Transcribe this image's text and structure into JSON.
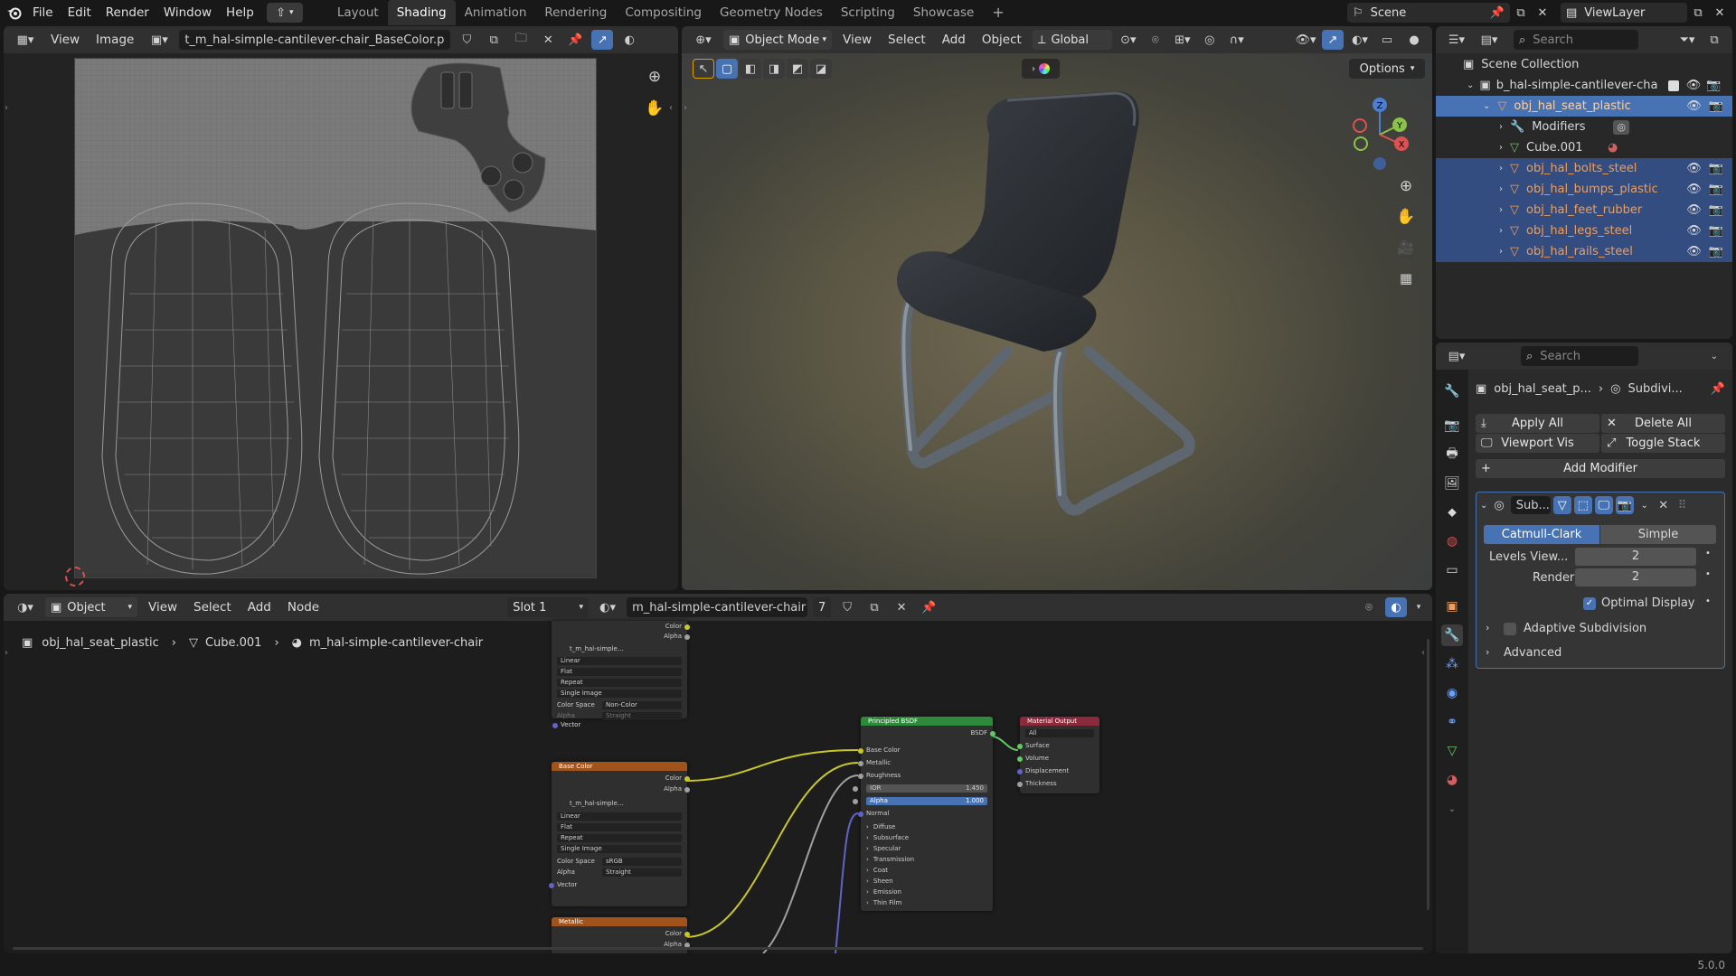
{
  "topbar": {
    "menus": [
      "File",
      "Edit",
      "Render",
      "Window",
      "Help"
    ],
    "workspaces": [
      "Layout",
      "Shading",
      "Animation",
      "Rendering",
      "Compositing",
      "Geometry Nodes",
      "Scripting",
      "Showcase"
    ],
    "active_workspace": "Shading",
    "scene": "Scene",
    "view_layer": "ViewLayer"
  },
  "image_editor": {
    "menus": [
      "View",
      "Image"
    ],
    "image_name": "t_m_hal-simple-cantilever-chair_BaseColor.png"
  },
  "viewport": {
    "mode": "Object Mode",
    "menus": [
      "View",
      "Select",
      "Add",
      "Object"
    ],
    "transform_orientation": "Global",
    "options_label": "Options",
    "gizmo": {
      "x": "X",
      "y": "Y",
      "z": "Z"
    }
  },
  "outliner": {
    "search_placeholder": "Search",
    "scene_collection": "Scene Collection",
    "collection": "b_hal-simple-cantilever-cha",
    "items": [
      {
        "label": "obj_hal_seat_plastic",
        "level": 1,
        "selected": true,
        "active": true
      },
      {
        "label": "Modifiers",
        "level": 2,
        "selected": false
      },
      {
        "label": "Cube.001",
        "level": 2,
        "selected": false
      },
      {
        "label": "obj_hal_bolts_steel",
        "level": 2,
        "selected": true
      },
      {
        "label": "obj_hal_bumps_plastic",
        "level": 2,
        "selected": true
      },
      {
        "label": "obj_hal_feet_rubber",
        "level": 2,
        "selected": true
      },
      {
        "label": "obj_hal_legs_steel",
        "level": 2,
        "selected": true
      },
      {
        "label": "obj_hal_rails_steel",
        "level": 2,
        "selected": true
      }
    ]
  },
  "properties": {
    "search_placeholder": "Search",
    "object_name": "obj_hal_seat_p...",
    "modifier_crumb": "Subdivi...",
    "apply_all": "Apply All",
    "delete_all": "Delete All",
    "viewport_vis": "Viewport Vis",
    "toggle_stack": "Toggle Stack",
    "add_modifier": "Add Modifier",
    "modifier_name": "Sub...",
    "catmull": "Catmull-Clark",
    "simple": "Simple",
    "levels_viewport_label": "Levels View...",
    "levels_viewport": "2",
    "render_label": "Render",
    "render_value": "2",
    "optimal_display": "Optimal Display",
    "adaptive": "Adaptive Subdivision",
    "advanced": "Advanced"
  },
  "node_editor": {
    "object_dropdown": "Object",
    "menus": [
      "View",
      "Select",
      "Add",
      "Node"
    ],
    "slot": "Slot 1",
    "material": "m_hal-simple-cantilever-chair",
    "users": "7",
    "breadcrumb": [
      "obj_hal_seat_plastic",
      "Cube.001",
      "m_hal-simple-cantilever-chair"
    ],
    "nodes": {
      "tex_top": {
        "outputs": [
          "Color",
          "Alpha"
        ],
        "image": "t_m_hal-simple...",
        "interp": "Linear",
        "proj": "Flat",
        "ext": "Repeat",
        "source": "Single Image",
        "cs_label": "Color Space",
        "cs": "Non-Color",
        "alpha_label": "Alpha",
        "alpha": "Straight",
        "vector": "Vector"
      },
      "base_color": {
        "title": "Base Color",
        "outputs": [
          "Color",
          "Alpha"
        ],
        "image": "t_m_hal-simple...",
        "interp": "Linear",
        "proj": "Flat",
        "ext": "Repeat",
        "source": "Single Image",
        "cs_label": "Color Space",
        "cs": "sRGB",
        "alpha_label": "Alpha",
        "alpha": "Straight",
        "vector": "Vector"
      },
      "metallic": {
        "title": "Metallic",
        "outputs": [
          "Color",
          "Alpha"
        ]
      },
      "bsdf": {
        "title": "Principled BSDF",
        "out": "BSDF",
        "inputs": [
          "Base Color",
          "Metallic",
          "Roughness"
        ],
        "ior_label": "IOR",
        "ior": "1.450",
        "alpha_label": "Alpha",
        "alpha": "1.000",
        "normal": "Normal",
        "panels": [
          "Diffuse",
          "Subsurface",
          "Specular",
          "Transmission",
          "Coat",
          "Sheen",
          "Emission",
          "Thin Film"
        ]
      },
      "output": {
        "title": "Material Output",
        "target": "All",
        "inputs": [
          "Surface",
          "Volume",
          "Displacement",
          "Thickness"
        ]
      }
    }
  },
  "status": {
    "version": "5.0.0"
  }
}
